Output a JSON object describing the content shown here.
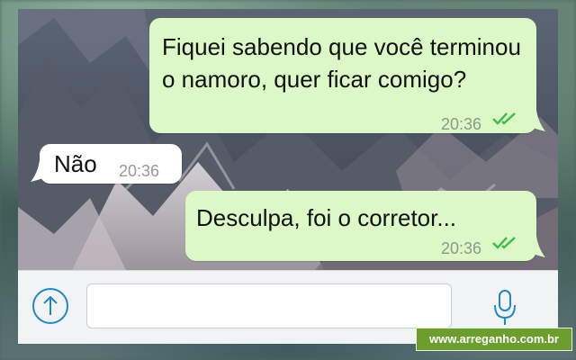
{
  "messages": [
    {
      "text": "Fiquei sabendo que você terminou o namoro, quer ficar comigo?",
      "time": "20:36",
      "direction": "outgoing",
      "status": "read"
    },
    {
      "text": "Não",
      "time": "20:36",
      "direction": "incoming"
    },
    {
      "text": "Desculpa, foi o corretor...",
      "time": "20:36",
      "direction": "outgoing",
      "status": "read"
    }
  ],
  "input": {
    "value": "",
    "placeholder": ""
  },
  "icons": {
    "attach": "upload-arrow-icon",
    "mic": "microphone-icon",
    "read": "double-check-icon"
  },
  "colors": {
    "outgoing_bubble": "#dcf8c6",
    "incoming_bubble": "#ffffff",
    "accent": "#1e88c9",
    "read_ticks": "#3dbb4f"
  },
  "watermark": "www.arreganho.com.br"
}
